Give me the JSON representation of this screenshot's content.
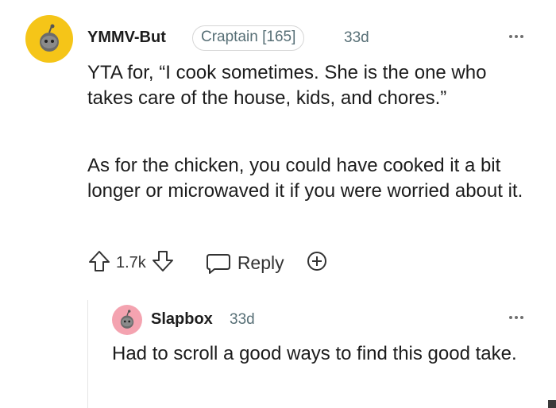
{
  "comment": {
    "username": "YMMV-But",
    "flair": "Craptain [165]",
    "time": "33d",
    "paragraphs": [
      "YTA for, “I cook sometimes. She is the one who takes care of the house, kids, and chores.”",
      "As for the chicken, you could have cooked it a bit longer or microwaved it if you were worried about it."
    ],
    "vote_count": "1.7k",
    "reply_label": "Reply",
    "avatar_color": "#f5c518"
  },
  "reply": {
    "username": "Slapbox",
    "time": "33d",
    "text": "Had to scroll a good ways to find this good take.",
    "avatar_color": "#f4a3b0"
  },
  "icons": [
    "more-options-icon",
    "upvote-icon",
    "downvote-icon",
    "comment-bubble-icon",
    "award-icon"
  ]
}
